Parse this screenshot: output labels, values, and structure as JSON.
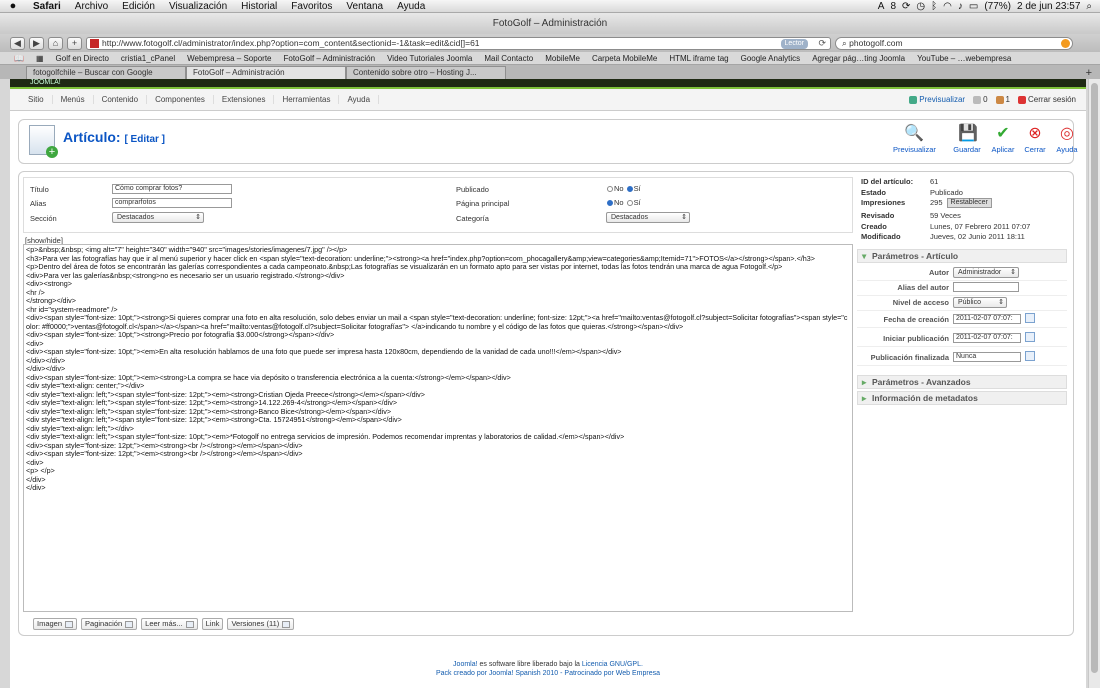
{
  "menubar": {
    "apple": "",
    "items": [
      "Safari",
      "Archivo",
      "Edición",
      "Visualización",
      "Historial",
      "Favoritos",
      "Ventana",
      "Ayuda"
    ],
    "status_a": "8",
    "battery": "(77%)",
    "datetime": "2 de jun  23:57"
  },
  "window": {
    "title": "FotoGolf – Administración"
  },
  "browser": {
    "back": "◀",
    "forward": "▶",
    "home": "⌂",
    "add": "+",
    "url": "http://www.fotogolf.cl/administrator/index.php?option=com_content&sectionid=-1&task=edit&cid[]=61",
    "reader": "Lector",
    "search": "photogolf.com"
  },
  "bookmarks": [
    "Golf en Directo",
    "cristia1_cPanel",
    "Webempresa – Soporte",
    "FotoGolf – Administración",
    "Video Tutoriales Joomla",
    "Mail Contacto",
    "MobileMe",
    "Carpeta MobileMe",
    "HTML iframe tag",
    "Google Analytics",
    "Agregar pág…ting Joomla",
    "YouTube – …webempresa"
  ],
  "tabs": [
    "fotogolfchile – Buscar con Google",
    "FotoGolf – Administración",
    "Contenido sobre otro – Hosting J..."
  ],
  "joomla": {
    "brand": "JOOMLA!",
    "menu": [
      "Sitio",
      "Menús",
      "Contenido",
      "Componentes",
      "Extensiones",
      "Herramientas",
      "Ayuda"
    ],
    "preview": "Previsualizar",
    "msgs": "0",
    "users": "1",
    "logout": "Cerrar sesión"
  },
  "header": {
    "title": "Artículo:",
    "subtitle": "[ Editar ]"
  },
  "toolbar": [
    "Previsualizar",
    "Guardar",
    "Aplicar",
    "Cerrar",
    "Ayuda"
  ],
  "form": {
    "titulo_label": "Título",
    "titulo_value": "Cómo comprar fotos?",
    "alias_label": "Alias",
    "alias_value": "comprarfotos",
    "seccion_label": "Sección",
    "seccion_value": "Destacados",
    "publicado_label": "Publicado",
    "pagina_label": "Página principal",
    "categoria_label": "Categoría",
    "categoria_value": "Destacados",
    "no": "No",
    "si": "Sí"
  },
  "editor": {
    "toggle": "[show/hide]",
    "content": "<p>&nbsp;&nbsp; <img alt=\"7\" height=\"340\" width=\"940\" src=\"images/stories/imagenes/7.jpg\" /></p>\n<h3>Para ver las fotografías hay que ir al menú superior y hacer click en <span style=\"text-decoration: underline;\"><strong><a href=\"index.php?option=com_phocagallery&amp;view=categories&amp;Itemid=71\">FOTOS</a></strong></span>.</h3>\n<p>Dentro del área de fotos se encontrarán las galerías correspondientes a cada campeonato.&nbsp;Las fotografías se visualizarán en un formato apto para ser vistas por internet, todas las fotos tendrán una marca de agua Fotogolf.</p>\n<div>Para ver las galerías&nbsp;<strong>no es necesario ser un usuario registrado.</strong></div>\n<div><strong>\n<hr />\n</strong></div>\n<hr id=\"system-readmore\" />\n<div><span style=\"font-size: 10pt;\"><strong>Si quieres comprar una foto en alta resolución, solo debes enviar un mail a <span style=\"text-decoration: underline; font-size: 12pt;\"><a href=\"mailto:ventas@fotogolf.cl?subject=Solicitar fotografías\"><span style=\"color: #ff0000;\">ventas@fotogolf.cl</span></a></span><a href=\"mailto:ventas@fotogolf.cl?subject=Solicitar fotografías\"> </a>indicando tu nombre y el código de las fotos que quieras.</strong></span></div>\n<div><span style=\"font-size: 10pt;\"><strong>Precio por fotografía $3.000</strong></span></div>\n<div>\n<div><span style=\"font-size: 10pt;\"><em>En alta resolución hablamos de una foto que puede ser impresa hasta 120x80cm, dependiendo de la vanidad de cada uno!!!</em></span></div>\n</div></div>\n</div></div>\n<div><span style=\"font-size: 10pt;\"><em><strong>La compra se hace via depósito o transferencia electrónica a la cuenta:</strong></em></span></div>\n<div style=\"text-align: center;\"></div>\n<div style=\"text-align: left;\"><span style=\"font-size: 12pt;\"><em><strong>Cristian Ojeda Preece</strong></em></span></div>\n<div style=\"text-align: left;\"><span style=\"font-size: 12pt;\"><em><strong>14.122.269-4</strong></em></span></div>\n<div style=\"text-align: left;\"><span style=\"font-size: 12pt;\"><em><strong>Banco Bice</strong></em></span></div>\n<div style=\"text-align: left;\"><span style=\"font-size: 12pt;\"><em><strong>Cta. 15724951</strong></em></span></div>\n<div style=\"text-align: left;\"></div>\n<div style=\"text-align: left;\"><span style=\"font-size: 10pt;\"><em>*Fotogolf no entrega servicios de impresión. Podemos recomendar imprentas y laboratorios de calidad.</em></span></div>\n<div><span style=\"font-size: 12pt;\"><em><strong><br /></strong></em></span></div>\n<div><span style=\"font-size: 12pt;\"><em><strong><br /></strong></em></span></div>\n<div>\n<p> </p>\n</div>\n</div>",
    "buttons": [
      "Imagen",
      "Paginación",
      "Leer más...",
      "Link",
      "Versiones (11)"
    ]
  },
  "info": {
    "id_label": "ID del artículo:",
    "id_value": "61",
    "estado_label": "Estado",
    "estado_value": "Publicado",
    "impresiones_label": "Impresiones",
    "impresiones_value": "295",
    "reset": "Restablecer",
    "revisado_label": "Revisado",
    "revisado_value": "59 Veces",
    "creado_label": "Creado",
    "creado_value": "Lunes, 07 Febrero 2011 07:07",
    "modificado_label": "Modificado",
    "modificado_value": "Jueves, 02 Junio 2011 18:11"
  },
  "params": {
    "panel_title": "Parámetros - Artículo",
    "autor_label": "Autor",
    "autor_value": "Administrador",
    "alias_autor_label": "Alias del autor",
    "alias_autor_value": "",
    "nivel_label": "Nivel de acceso",
    "nivel_value": "Público",
    "fecha_label": "Fecha de creación",
    "fecha_value": "2011-02-07 07:07:",
    "iniciar_label": "Iniciar publicación",
    "iniciar_value": "2011-02-07 07:07:",
    "fin_label": "Publicación finalizada",
    "fin_value": "Nunca",
    "avanzados": "Parámetros - Avanzados",
    "metadatos": "Información de metadatos"
  },
  "footer": {
    "line1_link": "Joomla!",
    "line1_mid": "es software libre liberado bajo la",
    "line1_license": "Licencia GNU/GPL.",
    "line2": "Pack creado por Joomla! Spanish 2010 - Patrocinado por Web Empresa"
  }
}
